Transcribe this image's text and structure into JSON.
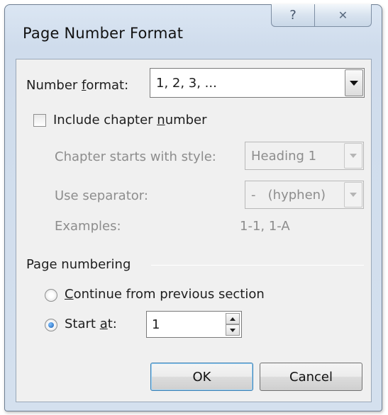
{
  "dialog": {
    "title": "Page Number Format",
    "help_icon": "?",
    "close_icon": "✕"
  },
  "number_format": {
    "label_prefix": "Number ",
    "label_accel": "f",
    "label_suffix": "ormat:",
    "value": "1, 2, 3, ..."
  },
  "chapter": {
    "checkbox_prefix": "Include chapter ",
    "checkbox_accel": "n",
    "checkbox_suffix": "umber",
    "checked": false,
    "starts_with_label": "Chapter starts with style:",
    "starts_with_value": "Heading 1",
    "separator_label": "Use separator:",
    "separator_value": "-   (hyphen)",
    "examples_label": "Examples:",
    "examples_value": "1-1, 1-A"
  },
  "page_numbering": {
    "group_label": "Page numbering",
    "continue_accel": "C",
    "continue_suffix": "ontinue from previous section",
    "start_prefix": "Start ",
    "start_accel": "a",
    "start_suffix": "t:",
    "selected": "start_at",
    "start_value": "1"
  },
  "buttons": {
    "ok": "OK",
    "cancel": "Cancel"
  }
}
